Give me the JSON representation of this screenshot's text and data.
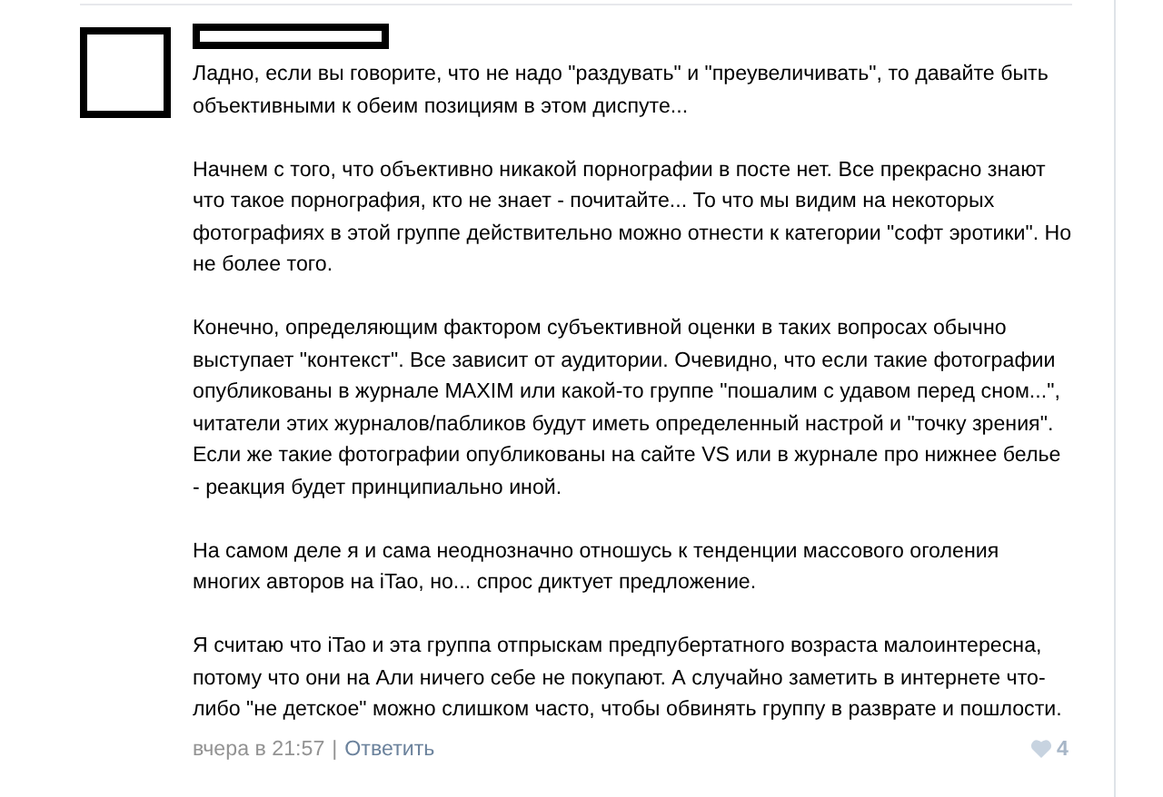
{
  "comment": {
    "paragraphs": [
      "Ладно, если вы говорите, что не надо \"раздувать\" и \"преувеличивать\", то давайте быть объективными к обеим позициям в этом диспуте...",
      "Начнем с того, что объективно никакой порнографии в посте нет. Все прекрасно знают что такое порнография, кто не знает - почитайте... То что мы видим на некоторых фотографиях в этой группе действительно можно отнести к категории \"софт эротики\". Но не более того.",
      "Конечно, определяющим фактором субъективной оценки в таких вопросах обычно выступает \"контекст\". Все зависит от аудитории. Очевидно, что если такие фотографии опубликованы в журнале MAXIM или какой-то группе \"пошалим с удавом перед сном...\", читатели этих журналов/пабликов будут иметь определенный настрой и \"точку зрения\". Если же такие фотографии опубликованы на сайте VS или в журнале про нижнее белье - реакция будет принципиально иной.",
      "На самом деле я и сама неоднозначно отношусь к тенденции массового оголения многих авторов на iTao, но... спрос диктует предложение.",
      "Я считаю что iTao и эта группа отпрыскам предпубертатного возраста малоинтересна, потому что они на Али ничего себе не покупают. А случайно заметить в интернете что-либо \"не детское\" можно слишком часто, чтобы обвинять группу в разврате и пошлости."
    ],
    "date": "вчера в 21:57",
    "separator": "|",
    "reply": "Ответить",
    "likes": "4"
  }
}
